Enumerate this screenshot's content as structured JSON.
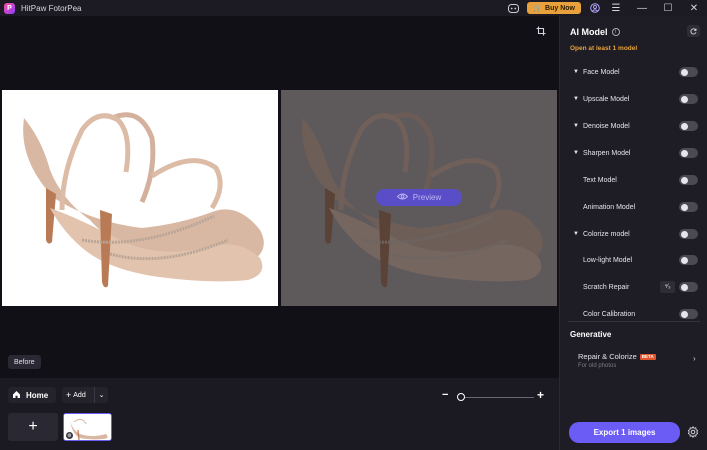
{
  "app": {
    "title": "HitPaw FotorPea",
    "logo_letter": "P"
  },
  "titlebar": {
    "buy_label": "Buy Now"
  },
  "canvas": {
    "preview_label": "Preview",
    "before_label": "Before"
  },
  "bottombar": {
    "home_label": "Home",
    "add_label": "Add",
    "add_tile_symbol": "+",
    "zoom": {
      "level_fraction": 0.0
    }
  },
  "panel": {
    "title": "AI Model",
    "hint": "Open at least 1 model",
    "models": [
      {
        "label": "Face Model",
        "expandable": true,
        "enabled": false
      },
      {
        "label": "Upscale Model",
        "expandable": true,
        "enabled": false
      },
      {
        "label": "Denoise Model",
        "expandable": true,
        "enabled": false
      },
      {
        "label": "Sharpen Model",
        "expandable": true,
        "enabled": false
      },
      {
        "label": "Text Model",
        "expandable": false,
        "enabled": false
      },
      {
        "label": "Animation Model",
        "expandable": false,
        "enabled": false
      },
      {
        "label": "Colorize model",
        "expandable": true,
        "enabled": false
      },
      {
        "label": "Low-light Model",
        "expandable": false,
        "enabled": false
      },
      {
        "label": "Scratch Repair",
        "expandable": false,
        "enabled": false
      },
      {
        "label": "Color Calibration",
        "expandable": false,
        "enabled": false
      }
    ],
    "generative": {
      "title": "Generative",
      "item_label": "Repair & Colorize",
      "item_badge": "BETA",
      "item_sub": "For old photos"
    },
    "export_label": "Export 1 images"
  },
  "colors": {
    "accent": "#6b5cf6",
    "buy": "#e9a23b",
    "hint": "#e8a23b"
  }
}
